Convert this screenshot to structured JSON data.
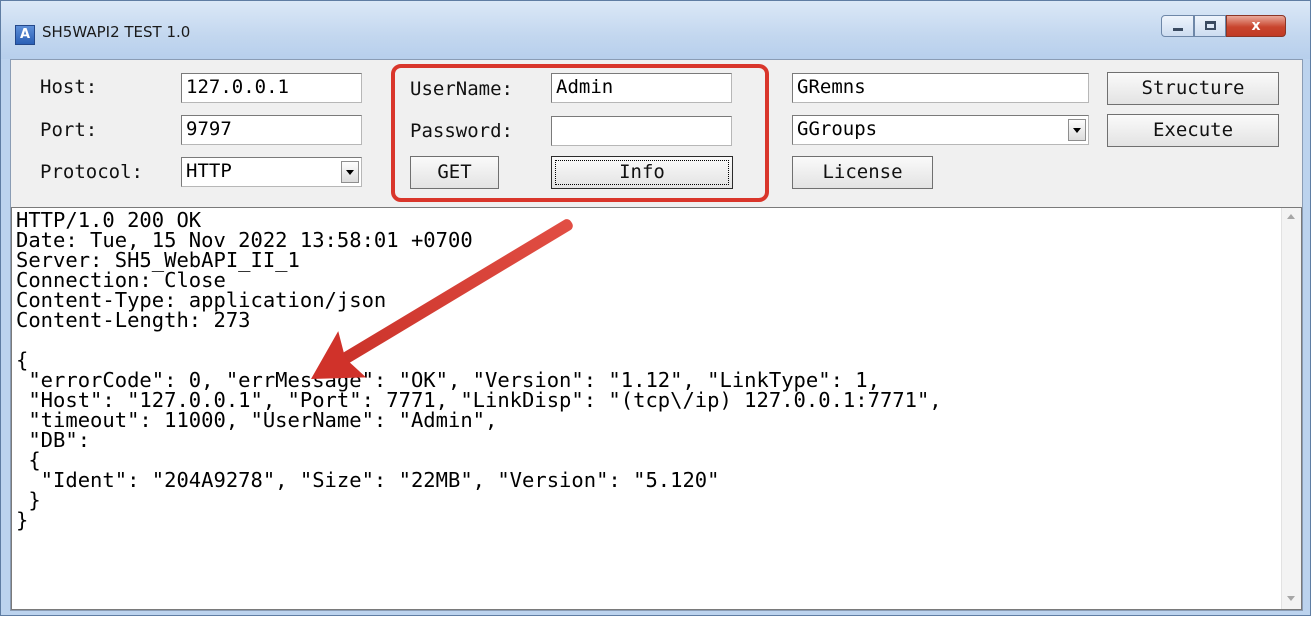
{
  "window": {
    "title": "SH5WAPI2 TEST 1.0",
    "icon": "app-icon",
    "icon_letter": "A",
    "controls": {
      "minimize": "minimize-icon",
      "maximize": "maximize-icon",
      "close": "close-icon",
      "close_glyph": "x"
    }
  },
  "connection": {
    "host_label": "Host:",
    "host_value": "127.0.0.1",
    "port_label": "Port:",
    "port_value": "9797",
    "protocol_label": "Protocol:",
    "protocol_value": "HTTP"
  },
  "credentials": {
    "username_label": "UserName:",
    "username_value": "Admin",
    "password_label": "Password:",
    "password_value": "",
    "get_button": "GET",
    "info_button": "Info"
  },
  "actions": {
    "gremns_value": "GRemns",
    "ggroups_value": "GGroups",
    "license_button": "License",
    "structure_button": "Structure",
    "execute_button": "Execute"
  },
  "output": {
    "text": "HTTP/1.0 200 OK\nDate: Tue, 15 Nov 2022 13:58:01 +0700\nServer: SH5_WebAPI_II_1\nConnection: Close\nContent-Type: application/json\nContent-Length: 273\n\n{\n \"errorCode\": 0, \"errMessage\": \"OK\", \"Version\": \"1.12\", \"LinkType\": 1,\n \"Host\": \"127.0.0.1\", \"Port\": 7771, \"LinkDisp\": \"(tcp\\/ip) 127.0.0.1:7771\",\n \"timeout\": 11000, \"UserName\": \"Admin\",\n \"DB\":\n {\n  \"Ident\": \"204A9278\", \"Size\": \"22MB\", \"Version\": \"5.120\"\n }\n}"
  },
  "colors": {
    "annotation_red": "#d9362b",
    "title_bar": "#c3d7ef",
    "dialog_bg": "#f0f0f0"
  }
}
